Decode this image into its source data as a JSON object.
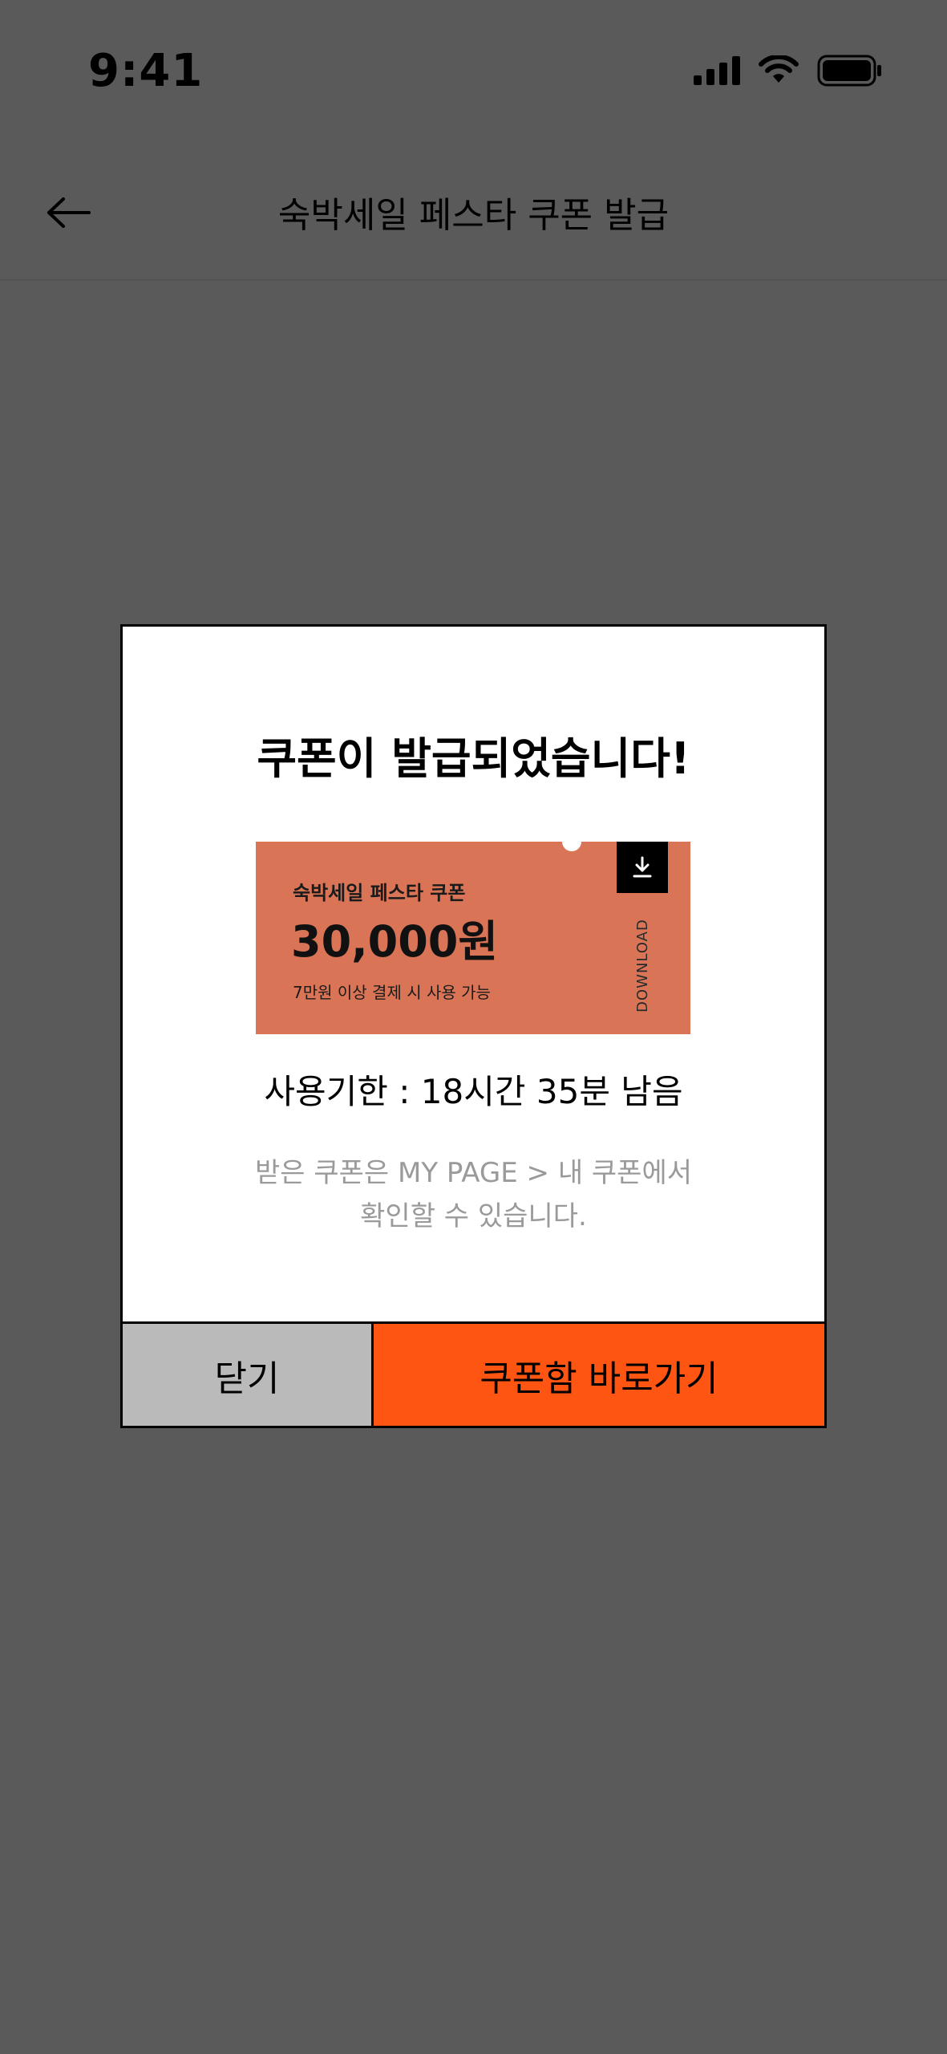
{
  "status_bar": {
    "time": "9:41"
  },
  "nav": {
    "title": "숙박세일 페스타 쿠폰 발급",
    "back_icon": "arrow-left-icon"
  },
  "dialog": {
    "title": "쿠폰이 발급되었습니다!",
    "coupon": {
      "name": "숙박세일 페스타 쿠폰",
      "amount": "30,000원",
      "condition": "7만원 이상 결제 시 사용 가능",
      "download_label": "DOWNLOAD",
      "color": "#d97556"
    },
    "expire_text": "사용기한 : 18시간 35분 남음",
    "info_line1": "받은 쿠폰은 MY PAGE > 내 쿠폰에서",
    "info_line2": "확인할 수 있습니다.",
    "close_label": "닫기",
    "go_label": "쿠폰함 바로가기",
    "accent_color": "#ff5512"
  }
}
